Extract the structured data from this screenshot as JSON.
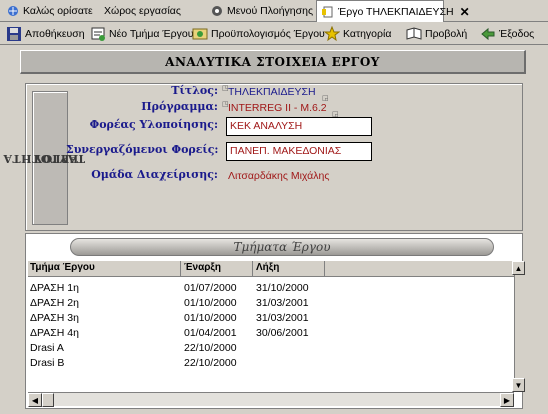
{
  "tabs": [
    {
      "label": "Καλώς ορίσατε",
      "icon": "welcome-icon"
    },
    {
      "label": "Χώρος εργασίας",
      "icon": "workspace-icon"
    },
    {
      "label": "Μενού Πλοήγησης",
      "icon": "navigation-icon"
    },
    {
      "label": "Έργο ΤΗΛΕΚΠΑΙΔΕΥΣΗ",
      "icon": "document-icon",
      "close": "✕"
    }
  ],
  "toolbar": {
    "save": "Αποθήκευση",
    "new_part": "Νέο Τμήμα Έργου",
    "budget": "Προϋπολογισμός Έργου",
    "category": "Κατηγορία",
    "view": "Προβολή",
    "exit": "Έξοδος"
  },
  "header": {
    "title": "ΑΝΑΛΥΤΙΚΑ ΣΤΟΙΧΕΙΑ ΕΡΓΟΥ"
  },
  "identity": {
    "side_label_line1": "ΤΑΥΤΟΤΗΤΑ",
    "side_label_line2": "ΕΡΓΟΥ",
    "title_label": "Τίτλος:",
    "title_value": "ΤΗΛΕΚΠΑΙΔΕΥΣΗ",
    "program_label": "Πρόγραμμα:",
    "program_value": "INTERREG II - M.6.2",
    "agency_label": "Φορέας Υλοποίησης:",
    "agency_value": "ΚΕΚ ΑΝΑΛΥΣΗ",
    "partners_label": "Συνεργαζόμενοι Φορείς:",
    "partners_value": "ΠΑΝΕΠ. ΜΑΚΕΔΟΝΙΑΣ",
    "team_label": "Ομάδα Διαχείρισης:",
    "team_value": "Λιτσαρδάκης Μιχάλης"
  },
  "parts": {
    "section_title": "Τμήματα Έργου",
    "columns": [
      "Τμήμα Έργου",
      "Έναρξη",
      "Λήξη"
    ],
    "rows": [
      [
        "ΔΡΑΣΗ 1η",
        "01/07/2000",
        "31/10/2000"
      ],
      [
        "ΔΡΑΣΗ 2η",
        "01/10/2000",
        "31/03/2001"
      ],
      [
        "ΔΡΑΣΗ 3η",
        "01/10/2000",
        "31/03/2001"
      ],
      [
        "ΔΡΑΣΗ 4η",
        "01/04/2001",
        "30/06/2001"
      ],
      [
        "Drasi A",
        "22/10/2000",
        ""
      ],
      [
        "Drasi B",
        "22/10/2000",
        ""
      ]
    ]
  }
}
